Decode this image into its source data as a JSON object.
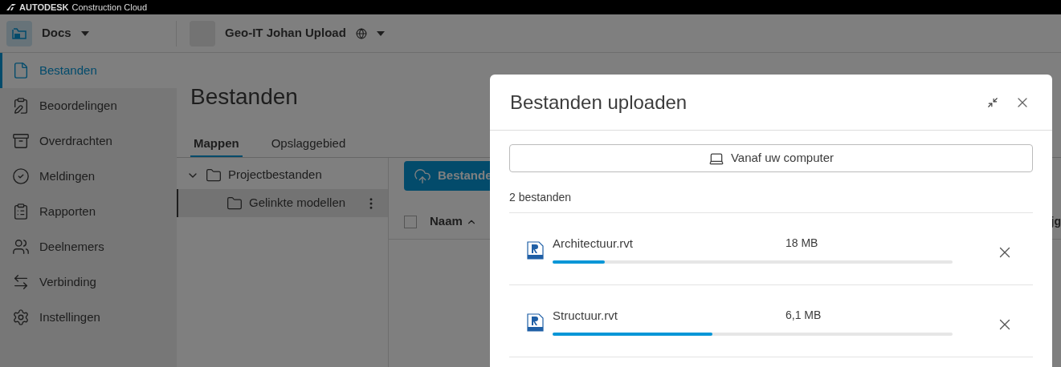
{
  "topbar": {
    "brand": "AUTODESK",
    "product": "Construction Cloud"
  },
  "header": {
    "module": "Docs",
    "project": "Geo-IT Johan Upload"
  },
  "sidebar": {
    "items": [
      {
        "label": "Bestanden",
        "kind": "file",
        "selected": true
      },
      {
        "label": "Beoordelingen",
        "kind": "review",
        "selected": false
      },
      {
        "label": "Overdrachten",
        "kind": "archive",
        "selected": false
      },
      {
        "label": "Meldingen",
        "kind": "check",
        "selected": false
      },
      {
        "label": "Rapporten",
        "kind": "report",
        "selected": false
      },
      {
        "label": "Deelnemers",
        "kind": "users",
        "selected": false
      },
      {
        "label": "Verbinding",
        "kind": "arrows",
        "selected": false
      },
      {
        "label": "Instellingen",
        "kind": "settings",
        "selected": false
      }
    ]
  },
  "page": {
    "title": "Bestanden",
    "tabs": [
      {
        "label": "Mappen",
        "selected": true
      },
      {
        "label": "Opslaggebied",
        "selected": false
      }
    ],
    "tree": [
      {
        "label": "Projectbestanden",
        "expanded": true,
        "selected": false,
        "children": [
          {
            "label": "Gelinkte modellen",
            "selected": true
          }
        ]
      }
    ],
    "upload_button": "Bestande",
    "table": {
      "select_all_checked": false,
      "columns": [
        "Naam",
        "jg"
      ]
    }
  },
  "dialog": {
    "title": "Bestanden uploaden",
    "source_button": "Vanaf uw computer",
    "count": "2 bestanden",
    "files": [
      {
        "name": "Architectuur.rvt",
        "size": "18 MB",
        "level": 0.13
      },
      {
        "name": "Structuur.rvt",
        "size": "6,1 MB",
        "level": 0.4
      }
    ]
  }
}
